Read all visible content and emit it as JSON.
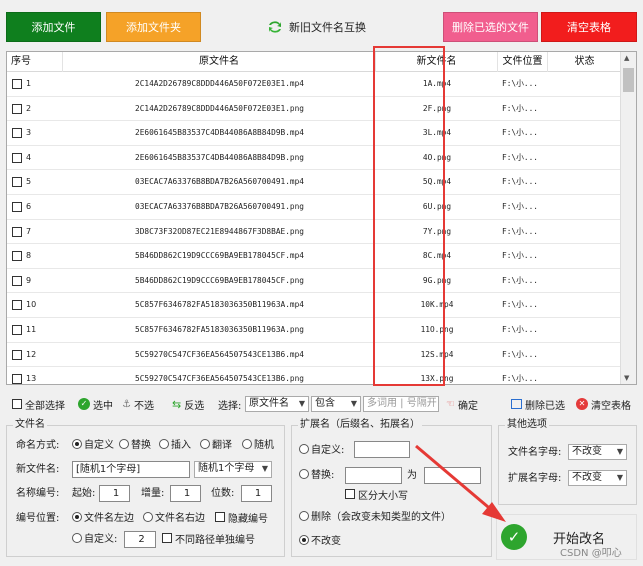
{
  "top_buttons": {
    "add_file": "添加文件",
    "add_folder": "添加文件夹",
    "swap": "新旧文件名互换",
    "delete_selected": "删除已选的文件",
    "clear_table": "清空表格"
  },
  "colors": {
    "add_file": "#0f7f1e",
    "add_folder": "#f5a228",
    "delete_selected": "#f15e8e",
    "clear_table": "#f21d1d",
    "highlight": "#e53935",
    "start_icon": "#2ea52e"
  },
  "table": {
    "headers": [
      "序号",
      "原文件名",
      "新文件名",
      "文件位置",
      "状态"
    ],
    "rows": [
      {
        "seq": "1",
        "orig": "2C14A2D26789C8DDD446A50F072E03E1.mp4",
        "new": "1A.mp4",
        "loc": "F:\\小...",
        "status": ""
      },
      {
        "seq": "2",
        "orig": "2C14A2D26789C8DDD446A50F072E03E1.png",
        "new": "2F.png",
        "loc": "F:\\小...",
        "status": ""
      },
      {
        "seq": "3",
        "orig": "2E6061645B83537C4DB44086A8B84D9B.mp4",
        "new": "3L.mp4",
        "loc": "F:\\小...",
        "status": ""
      },
      {
        "seq": "4",
        "orig": "2E6061645B83537C4DB44086A8B84D9B.png",
        "new": "4O.png",
        "loc": "F:\\小...",
        "status": ""
      },
      {
        "seq": "5",
        "orig": "03ECAC7A63376B8BDA7B26A560700491.mp4",
        "new": "5Q.mp4",
        "loc": "F:\\小...",
        "status": ""
      },
      {
        "seq": "6",
        "orig": "03ECAC7A63376B8BDA7B26A560700491.png",
        "new": "6U.png",
        "loc": "F:\\小...",
        "status": ""
      },
      {
        "seq": "7",
        "orig": "3D8C73F32OD87EC21E8944867F3D8BAE.png",
        "new": "7Y.png",
        "loc": "F:\\小...",
        "status": ""
      },
      {
        "seq": "8",
        "orig": "5B46DD862C19D9CCC69BA9EB178045CF.mp4",
        "new": "8C.mp4",
        "loc": "F:\\小...",
        "status": ""
      },
      {
        "seq": "9",
        "orig": "5B46DD862C19D9CCC69BA9EB178045CF.png",
        "new": "9G.png",
        "loc": "F:\\小...",
        "status": ""
      },
      {
        "seq": "10",
        "orig": "5C857F6346782FA5183036350B11963A.mp4",
        "new": "10K.mp4",
        "loc": "F:\\小...",
        "status": ""
      },
      {
        "seq": "11",
        "orig": "5C857F6346782FA5183036350B11963A.png",
        "new": "11O.png",
        "loc": "F:\\小...",
        "status": ""
      },
      {
        "seq": "12",
        "orig": "5C59270C547CF36EA564507543CE13B6.mp4",
        "new": "12S.mp4",
        "loc": "F:\\小...",
        "status": ""
      },
      {
        "seq": "13",
        "orig": "5C59270C547CF36EA564507543CE13B6.png",
        "new": "13X.png",
        "loc": "F:\\小...",
        "status": ""
      }
    ]
  },
  "toolbar": {
    "select_all": "全部选择",
    "select": "选中",
    "unselect": "不选",
    "invert": "反选",
    "choose": "选择:",
    "field": "原文件名",
    "match": "包含",
    "placeholder": "多词用 | 号隔开",
    "confirm": "确定",
    "delete_selected": "删除已选",
    "clear_table": "清空表格"
  },
  "filename_group": {
    "title": "文件名",
    "naming_mode_label": "命名方式:",
    "modes": [
      "自定义",
      "替换",
      "插入",
      "翻译",
      "随机"
    ],
    "new_name_label": "新文件名:",
    "new_name_value": "[随机1个字母]",
    "new_name_select": "随机1个字母",
    "numbering_label": "名称编号:",
    "start_label": "起始:",
    "start_value": "1",
    "step_label": "增量:",
    "step_value": "1",
    "digits_label": "位数:",
    "digits_value": "1",
    "position_label": "编号位置:",
    "pos_left": "文件名左边",
    "pos_right": "文件名右边",
    "hide_number": "隐藏编号",
    "pos_custom": "自定义:",
    "custom_value": "2",
    "separate_path": "不同路径单独编号"
  },
  "ext_group": {
    "title": "扩展名（后缀名、拓展名）",
    "custom": "自定义:",
    "replace": "替换:",
    "replace_to": "为",
    "case_sensitive": "区分大小写",
    "delete": "删除（会改变未知类型的文件）",
    "no_change": "不改变"
  },
  "other_group": {
    "title": "其他选项",
    "filename_case_label": "文件名字母:",
    "filename_case_value": "不改变",
    "ext_case_label": "扩展名字母:",
    "ext_case_value": "不改变"
  },
  "start_button": "开始改名",
  "watermark": "CSDN @叩心"
}
